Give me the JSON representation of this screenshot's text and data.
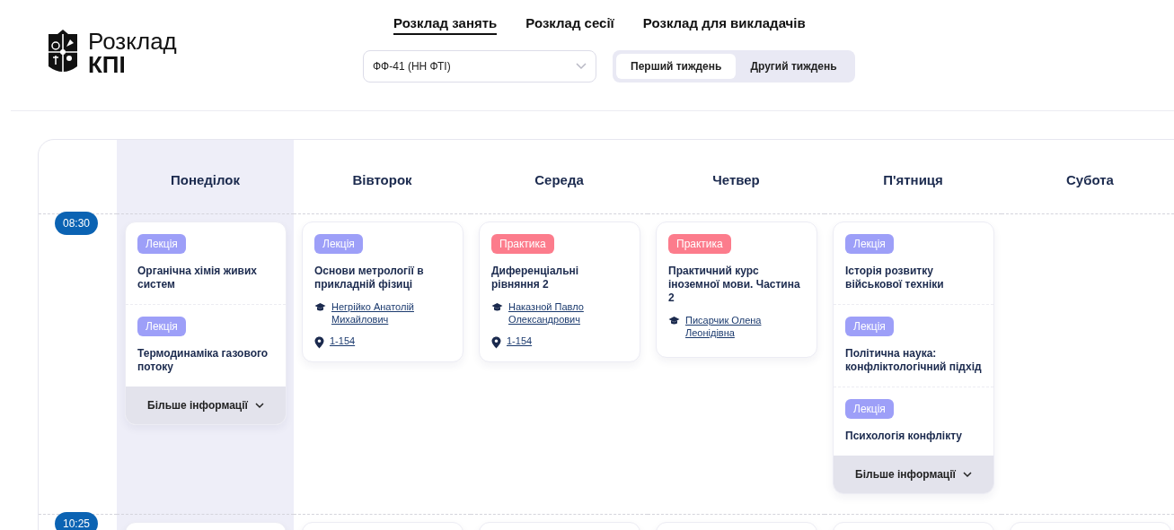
{
  "logo": {
    "line_1": "Розклад",
    "line_2": "КПІ"
  },
  "nav": [
    {
      "label": "Розклад занять",
      "selected": true
    },
    {
      "label": "Розклад сесії",
      "selected": false
    },
    {
      "label": "Розклад для викладачів",
      "selected": false
    }
  ],
  "group_select": {
    "value": "ФФ-41 (НН ФТІ)"
  },
  "weeks": [
    {
      "label": "Перший тиждень",
      "selected": true
    },
    {
      "label": "Другий тиждень",
      "selected": false
    }
  ],
  "days": [
    {
      "label": "Понеділок",
      "selected": true
    },
    {
      "label": "Вівторок",
      "selected": false
    },
    {
      "label": "Середа",
      "selected": false
    },
    {
      "label": "Четвер",
      "selected": false
    },
    {
      "label": "П'ятниця",
      "selected": false
    },
    {
      "label": "Субота",
      "selected": false
    }
  ],
  "slots": [
    {
      "time": "08:30",
      "cells": [
        {
          "kind": "card",
          "more": "Більше інформації",
          "lessons": [
            {
              "kind": "lecture",
              "type": "Лекція",
              "title": "Органічна хімія живих систем"
            },
            {
              "kind": "lecture",
              "type": "Лекція",
              "title": "Термодинаміка газового потоку"
            }
          ]
        },
        {
          "kind": "card",
          "lessons": [
            {
              "kind": "lecture",
              "type": "Лекція",
              "title": "Основи метрології в прикладній фізиці",
              "teacher": "Негрійко Анатолій Михайлович",
              "room": "1-154"
            }
          ]
        },
        {
          "kind": "card",
          "lessons": [
            {
              "kind": "practice",
              "type": "Практика",
              "title": "Диференціальні рівняння 2",
              "teacher": "Наказной Павло Олександрович",
              "room": "1-154"
            }
          ]
        },
        {
          "kind": "card",
          "lessons": [
            {
              "kind": "practice",
              "type": "Практика",
              "title": "Практичний курс іноземної мови. Частина 2",
              "teacher": "Писарчик Олена Леонідівна"
            }
          ]
        },
        {
          "kind": "card",
          "more": "Більше інформації",
          "lessons": [
            {
              "kind": "lecture",
              "type": "Лекція",
              "title": "Історія розвитку військової техніки"
            },
            {
              "kind": "lecture",
              "type": "Лекція",
              "title": "Політична наука: конфліктологічний підхід"
            },
            {
              "kind": "lecture",
              "type": "Лекція",
              "title": "Психологія конфлікту"
            }
          ]
        },
        {
          "kind": "empty"
        }
      ]
    },
    {
      "time": "10:25",
      "cells": [
        {
          "kind": "card"
        },
        {
          "kind": "card"
        },
        {
          "kind": "card"
        },
        {
          "kind": "card"
        },
        {
          "kind": "card"
        },
        {
          "kind": "card"
        }
      ]
    }
  ]
}
